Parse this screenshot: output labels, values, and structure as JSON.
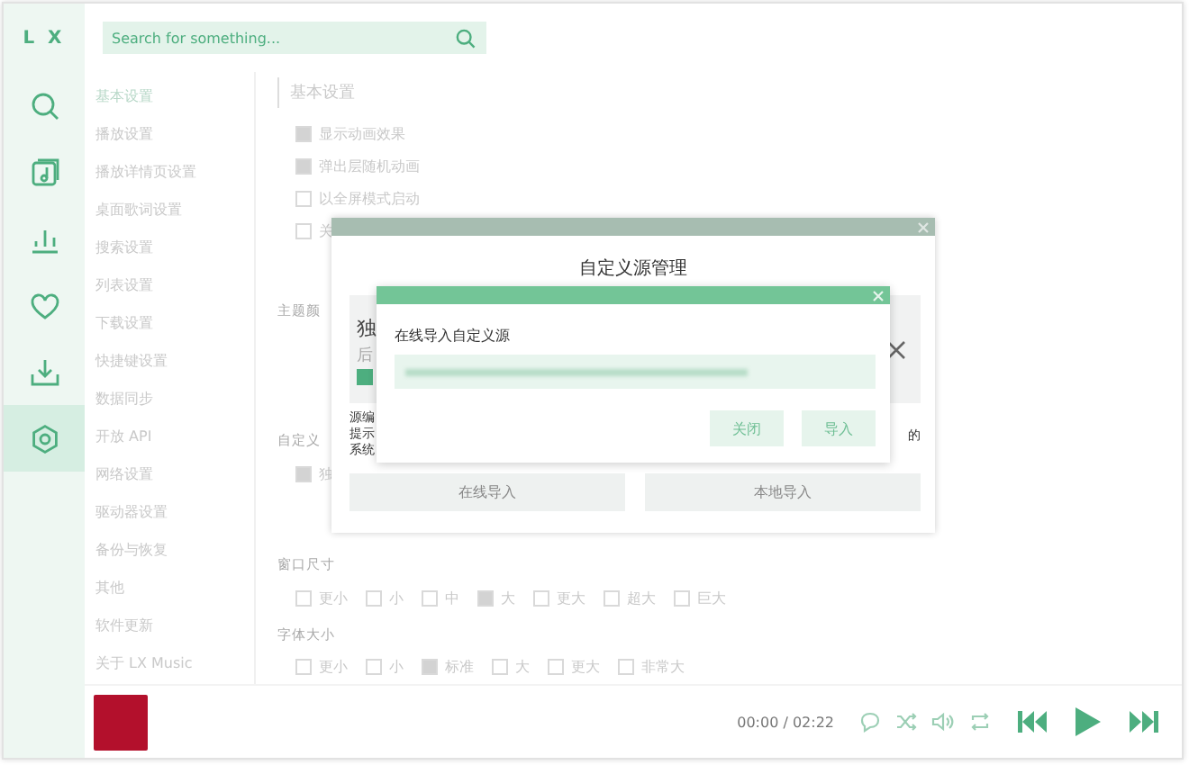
{
  "logo": "L X",
  "sidebar": {
    "items": [
      {
        "kind": "search",
        "selected": false
      },
      {
        "kind": "music-list",
        "selected": false
      },
      {
        "kind": "chart",
        "selected": false
      },
      {
        "kind": "heart",
        "selected": false
      },
      {
        "kind": "download",
        "selected": false
      },
      {
        "kind": "settings",
        "selected": true
      }
    ]
  },
  "search": {
    "placeholder": "Search for something..."
  },
  "settings_nav": {
    "items": [
      {
        "label": "基本设置",
        "selected": true
      },
      {
        "label": "播放设置",
        "selected": false
      },
      {
        "label": "播放详情页设置",
        "selected": false
      },
      {
        "label": "桌面歌词设置",
        "selected": false
      },
      {
        "label": "搜索设置",
        "selected": false
      },
      {
        "label": "列表设置",
        "selected": false
      },
      {
        "label": "下载设置",
        "selected": false
      },
      {
        "label": "快捷键设置",
        "selected": false
      },
      {
        "label": "数据同步",
        "selected": false
      },
      {
        "label": "开放 API",
        "selected": false
      },
      {
        "label": "网络设置",
        "selected": false
      },
      {
        "label": "驱动器设置",
        "selected": false
      },
      {
        "label": "备份与恢复",
        "selected": false
      },
      {
        "label": "其他",
        "selected": false
      },
      {
        "label": "软件更新",
        "selected": false
      },
      {
        "label": "关于 LX Music",
        "selected": false
      }
    ]
  },
  "settings": {
    "heading": "基本设置",
    "options": [
      {
        "label": "显示动画效果",
        "checked": true
      },
      {
        "label": "弹出层随机动画",
        "checked": true
      },
      {
        "label": "以全屏模式启动",
        "checked": false
      },
      {
        "label": "关",
        "checked": false
      }
    ],
    "theme_label": "主题颜",
    "source_label": "自定义",
    "source_option": {
      "label": "独",
      "checked": true
    },
    "window_size": {
      "label": "窗口尺寸",
      "options": [
        {
          "label": "更小",
          "selected": false
        },
        {
          "label": "小",
          "selected": false
        },
        {
          "label": "中",
          "selected": false
        },
        {
          "label": "大",
          "selected": true
        },
        {
          "label": "更大",
          "selected": false
        },
        {
          "label": "超大",
          "selected": false
        },
        {
          "label": "巨大",
          "selected": false
        }
      ]
    },
    "font_size": {
      "label": "字体大小",
      "options": [
        {
          "label": "更小",
          "selected": false
        },
        {
          "label": "小",
          "selected": false
        },
        {
          "label": "标准",
          "selected": true
        },
        {
          "label": "大",
          "selected": false
        },
        {
          "label": "更大",
          "selected": false
        },
        {
          "label": "非常大",
          "selected": false
        }
      ]
    }
  },
  "source_dialog": {
    "title": "自定义源管理",
    "card": {
      "name": "独",
      "line": "后",
      "checked": true
    },
    "notes": [
      "源编",
      "提示",
      "系统"
    ],
    "note_tail": "的",
    "buttons": [
      "在线导入",
      "本地导入"
    ]
  },
  "import_dialog": {
    "title": "在线导入自定义源",
    "buttons": [
      "关闭",
      "导入"
    ]
  },
  "player": {
    "time": "00:00 / 02:22"
  }
}
